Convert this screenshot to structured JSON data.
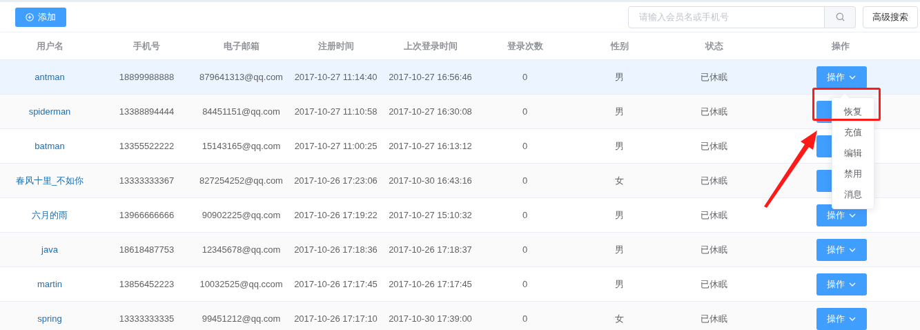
{
  "toolbar": {
    "add_button": "添加",
    "search": {
      "placeholder": "请输入会员名或手机号"
    },
    "advanced_search_button": "高级搜索"
  },
  "table": {
    "columns": [
      "用户名",
      "手机号",
      "电子邮箱",
      "注册时间",
      "上次登录时间",
      "登录次数",
      "性别",
      "状态",
      "操作"
    ],
    "rows": [
      {
        "username": "antman",
        "phone": "18899988888",
        "email": "879641313@qq.com",
        "registered": "2017-10-27 11:14:40",
        "last_login": "2017-10-27 16:56:46",
        "login_count": "0",
        "gender": "男",
        "status": "已休眠",
        "action": "操作",
        "highlighted": true
      },
      {
        "username": "spiderman",
        "phone": "13388894444",
        "email": "84451151@qq.com",
        "registered": "2017-10-27 11:10:58",
        "last_login": "2017-10-27 16:30:08",
        "login_count": "0",
        "gender": "男",
        "status": "已休眠",
        "highlighted": false
      },
      {
        "username": "batman",
        "phone": "13355522222",
        "email": "15143165@qq.com",
        "registered": "2017-10-27 11:00:25",
        "last_login": "2017-10-27 16:13:12",
        "login_count": "0",
        "gender": "男",
        "status": "已休眠",
        "highlighted": false
      },
      {
        "username": "春风十里_不如你",
        "phone": "13333333367",
        "email": "827254252@qq.com",
        "registered": "2017-10-26 17:23:06",
        "last_login": "2017-10-30 16:43:16",
        "login_count": "0",
        "gender": "女",
        "status": "已休眠",
        "highlighted": false
      },
      {
        "username": "六月的雨",
        "phone": "13966666666",
        "email": "90902225@qq.com",
        "registered": "2017-10-26 17:19:22",
        "last_login": "2017-10-27 15:10:32",
        "login_count": "0",
        "gender": "男",
        "status": "已休眠",
        "action": "操作",
        "highlighted": false
      },
      {
        "username": "java",
        "phone": "18618487753",
        "email": "12345678@qq.com",
        "registered": "2017-10-26 17:18:36",
        "last_login": "2017-10-26 17:18:37",
        "login_count": "0",
        "gender": "男",
        "status": "已休眠",
        "action": "操作",
        "highlighted": false
      },
      {
        "username": "martin",
        "phone": "13856452223",
        "email": "10032525@qq.ccom",
        "registered": "2017-10-26 17:17:45",
        "last_login": "2017-10-26 17:17:45",
        "login_count": "0",
        "gender": "男",
        "status": "已休眠",
        "action": "操作",
        "highlighted": false
      },
      {
        "username": "spring",
        "phone": "13333333335",
        "email": "99451212@qq.com",
        "registered": "2017-10-26 17:17:10",
        "last_login": "2017-10-30 17:39:00",
        "login_count": "0",
        "gender": "女",
        "status": "已休眠",
        "action": "操作",
        "highlighted": false
      }
    ]
  },
  "dropdown": {
    "items": [
      "恢复",
      "充值",
      "编辑",
      "禁用",
      "消息"
    ]
  }
}
